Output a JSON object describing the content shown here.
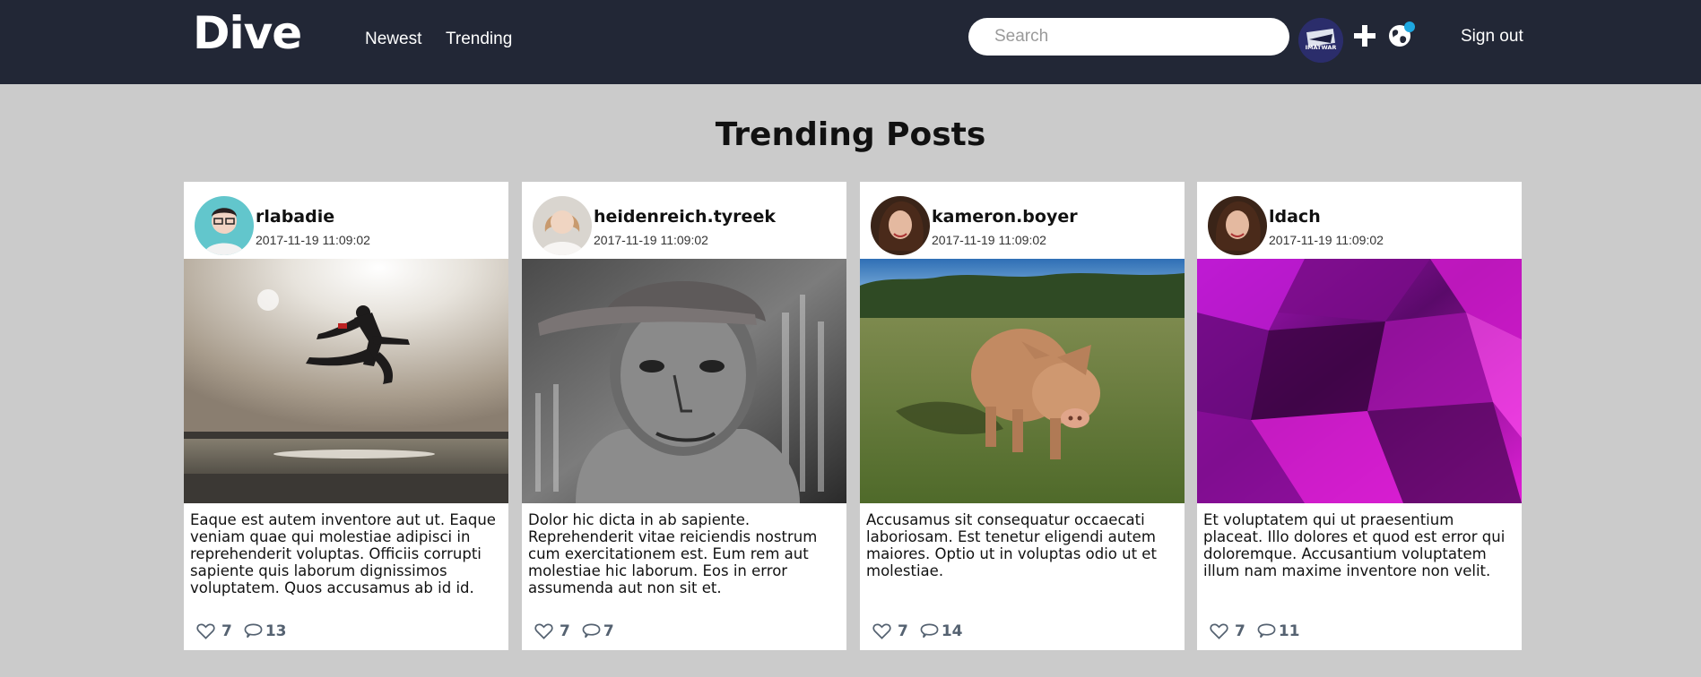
{
  "header": {
    "logo": "Dive",
    "nav": [
      "Newest",
      "Trending"
    ],
    "search_placeholder": "Search",
    "avatar_label": "IMATWAR",
    "signout_label": "Sign out",
    "icons": [
      "plus-icon",
      "globe-icon"
    ],
    "notification_color": "#1ea7e0",
    "bg_color": "#222736"
  },
  "page": {
    "title": "Trending Posts"
  },
  "posts": [
    {
      "username": "rlabadie",
      "date": "2017-11-19 11:09:02",
      "body": "Eaque est autem inventore aut ut. Eaque veniam quae qui molestiae adipisci in reprehenderit voluptas. Officiis corrupti sapiente quis laborum dignissimos voluptatem. Quos accusamus ab id id.",
      "likes": "7",
      "comments": "13",
      "image_desc": "silhouette-jump-sunset"
    },
    {
      "username": "heidenreich.tyreek",
      "date": "2017-11-19 11:09:02",
      "body": "Dolor hic dicta in ab sapiente. Reprehenderit vitae reiciendis nostrum cum exercitationem est. Eum rem aut molestiae hic laborum. Eos in error assumenda aut non sit et.",
      "likes": "7",
      "comments": "7",
      "image_desc": "old-man-portrait"
    },
    {
      "username": "kameron.boyer",
      "date": "2017-11-19 11:09:02",
      "body": "Accusamus sit consequatur occaecati laboriosam. Est tenetur eligendi autem maiores. Optio ut in voluptas odio ut et molestiae.",
      "likes": "7",
      "comments": "14",
      "image_desc": "pig-in-field"
    },
    {
      "username": "ldach",
      "date": "2017-11-19 11:09:02",
      "body": "Et voluptatem qui ut praesentium placeat. Illo dolores et quod est error qui doloremque. Accusantium voluptatem illum nam maxime inventore non velit.",
      "likes": "7",
      "comments": "11",
      "image_desc": "purple-abstract"
    }
  ]
}
